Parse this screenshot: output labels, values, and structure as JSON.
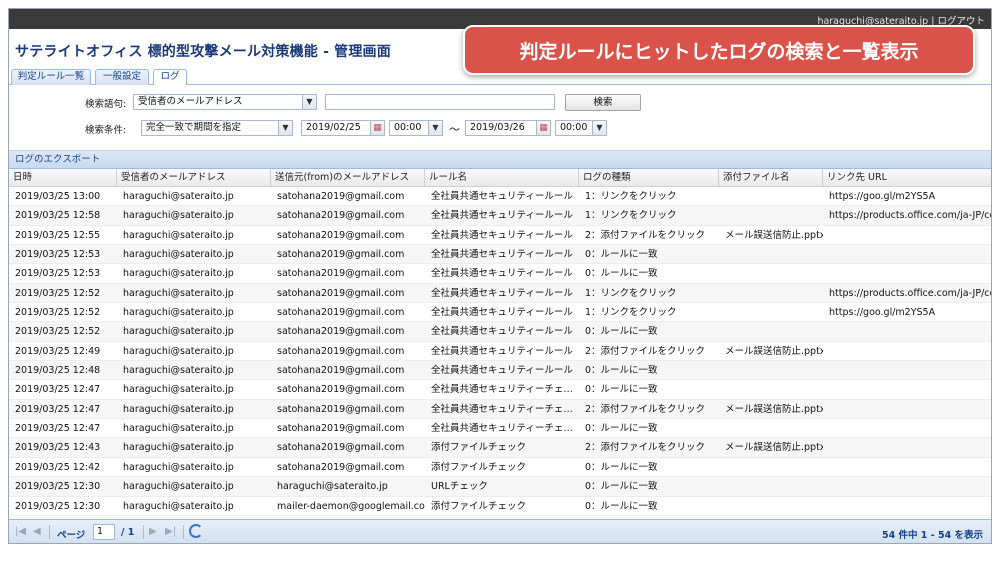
{
  "header": {
    "user_email": "haraguchi@sateraito.jp",
    "logout_label": "ログアウト",
    "app_title": "サテライトオフィス 標的型攻撃メール対策機能 - 管理画面"
  },
  "callout": {
    "text": "判定ルールにヒットしたログの検索と一覧表示",
    "color": "#d9534b"
  },
  "tabs": [
    {
      "label": "判定ルール一覧",
      "active": false
    },
    {
      "label": "一般設定",
      "active": false
    },
    {
      "label": "ログ",
      "active": true
    }
  ],
  "search": {
    "keyword_label": "検索語句:",
    "field_select": "受信者のメールアドレス",
    "keyword_value": "",
    "search_button": "検索",
    "condition_label": "検索条件:",
    "condition_select": "完全一致で期間を指定",
    "date_from": "2019/02/25",
    "time_from": "00:00",
    "range_sep": "〜",
    "date_to": "2019/03/26",
    "time_to": "00:00"
  },
  "export": {
    "label": "ログのエクスポート"
  },
  "table": {
    "columns": [
      "日時",
      "受信者のメールアドレス",
      "送信元(from)のメールアドレス",
      "ルール名",
      "ログの種類",
      "添付ファイル名",
      "リンク先 URL"
    ],
    "rows": [
      [
        "2019/03/25 13:00",
        "haraguchi@sateraito.jp",
        "satohana2019@gmail.com",
        "全社員共通セキュリティールール",
        "1：リンクをクリック",
        "",
        "https://goo.gl/m2YS5A"
      ],
      [
        "2019/03/25 12:58",
        "haraguchi@sateraito.jp",
        "satohana2019@gmail.com",
        "全社員共通セキュリティールール",
        "1：リンクをクリック",
        "",
        "https://products.office.com/ja-JP/compare"
      ],
      [
        "2019/03/25 12:55",
        "haraguchi@sateraito.jp",
        "satohana2019@gmail.com",
        "全社員共通セキュリティールール",
        "2：添付ファイルをクリック",
        "メール誤送信防止.pptx",
        ""
      ],
      [
        "2019/03/25 12:53",
        "haraguchi@sateraito.jp",
        "satohana2019@gmail.com",
        "全社員共通セキュリティールール",
        "0：ルールに一致",
        "",
        ""
      ],
      [
        "2019/03/25 12:53",
        "haraguchi@sateraito.jp",
        "satohana2019@gmail.com",
        "全社員共通セキュリティールール",
        "0：ルールに一致",
        "",
        ""
      ],
      [
        "2019/03/25 12:52",
        "haraguchi@sateraito.jp",
        "satohana2019@gmail.com",
        "全社員共通セキュリティールール",
        "1：リンクをクリック",
        "",
        "https://products.office.com/ja-JP/compare"
      ],
      [
        "2019/03/25 12:52",
        "haraguchi@sateraito.jp",
        "satohana2019@gmail.com",
        "全社員共通セキュリティールール",
        "1：リンクをクリック",
        "",
        "https://goo.gl/m2YS5A"
      ],
      [
        "2019/03/25 12:52",
        "haraguchi@sateraito.jp",
        "satohana2019@gmail.com",
        "全社員共通セキュリティールール",
        "0：ルールに一致",
        "",
        ""
      ],
      [
        "2019/03/25 12:49",
        "haraguchi@sateraito.jp",
        "satohana2019@gmail.com",
        "全社員共通セキュリティールール",
        "2：添付ファイルをクリック",
        "メール誤送信防止.pptx",
        ""
      ],
      [
        "2019/03/25 12:48",
        "haraguchi@sateraito.jp",
        "satohana2019@gmail.com",
        "全社員共通セキュリティールール",
        "0：ルールに一致",
        "",
        ""
      ],
      [
        "2019/03/25 12:47",
        "haraguchi@sateraito.jp",
        "satohana2019@gmail.com",
        "全社員共通セキュリティーチェ…",
        "0：ルールに一致",
        "",
        ""
      ],
      [
        "2019/03/25 12:47",
        "haraguchi@sateraito.jp",
        "satohana2019@gmail.com",
        "全社員共通セキュリティーチェ…",
        "2：添付ファイルをクリック",
        "メール誤送信防止.pptx",
        ""
      ],
      [
        "2019/03/25 12:47",
        "haraguchi@sateraito.jp",
        "satohana2019@gmail.com",
        "全社員共通セキュリティーチェ…",
        "0：ルールに一致",
        "",
        ""
      ],
      [
        "2019/03/25 12:43",
        "haraguchi@sateraito.jp",
        "satohana2019@gmail.com",
        "添付ファイルチェック",
        "2：添付ファイルをクリック",
        "メール誤送信防止.pptx",
        ""
      ],
      [
        "2019/03/25 12:42",
        "haraguchi@sateraito.jp",
        "satohana2019@gmail.com",
        "添付ファイルチェック",
        "0：ルールに一致",
        "",
        ""
      ],
      [
        "2019/03/25 12:30",
        "haraguchi@sateraito.jp",
        "haraguchi@sateraito.jp",
        "URLチェック",
        "0：ルールに一致",
        "",
        ""
      ],
      [
        "2019/03/25 12:30",
        "haraguchi@sateraito.jp",
        "mailer-daemon@googlemail.com",
        "添付ファイルチェック",
        "0：ルールに一致",
        "",
        ""
      ]
    ]
  },
  "pager": {
    "page_label": "ページ",
    "page_value": "1",
    "total_pages": "/ 1",
    "info": "54 件中 1 - 54 を表示"
  }
}
